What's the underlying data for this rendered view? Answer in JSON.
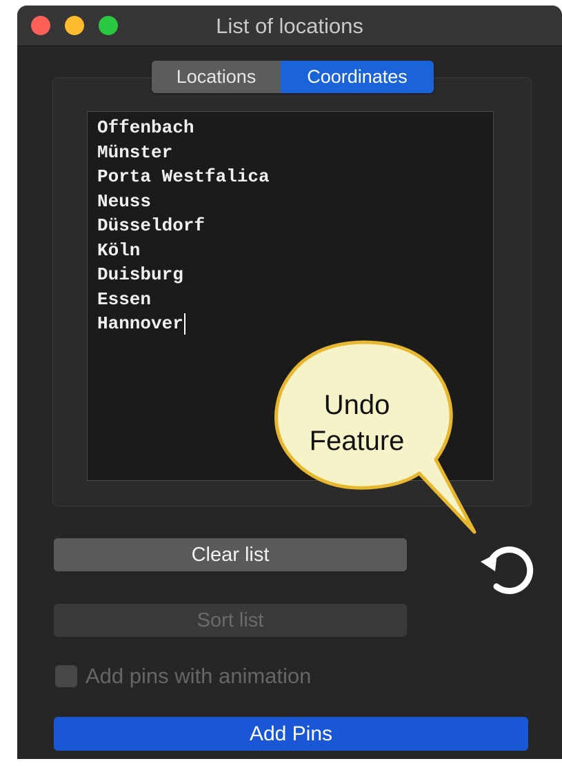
{
  "window": {
    "title": "List of locations",
    "traffic_lights": [
      "close",
      "minimize",
      "zoom"
    ]
  },
  "tabs": {
    "items": [
      {
        "label": "Locations",
        "selected": false
      },
      {
        "label": "Coordinates",
        "selected": true
      }
    ]
  },
  "locations_text": {
    "lines": [
      "Offenbach",
      "Münster",
      "Porta Westfalica",
      "Neuss",
      "Düsseldorf",
      "Köln",
      "Duisburg",
      "Essen",
      "Hannover"
    ]
  },
  "callout": {
    "line1": "Undo",
    "line2": "Feature",
    "fill_color": "#f6f3c9",
    "stroke_color": "#e8b730"
  },
  "buttons": {
    "clear_label": "Clear list",
    "sort_label": "Sort list",
    "sort_enabled": false,
    "add_pins_label": "Add Pins",
    "undo_icon": "undo-icon"
  },
  "options": {
    "animation_label": "Add pins with animation",
    "animation_checked": false,
    "animation_enabled": false
  },
  "colors": {
    "accent": "#1a57d6",
    "window_bg": "#262626"
  }
}
